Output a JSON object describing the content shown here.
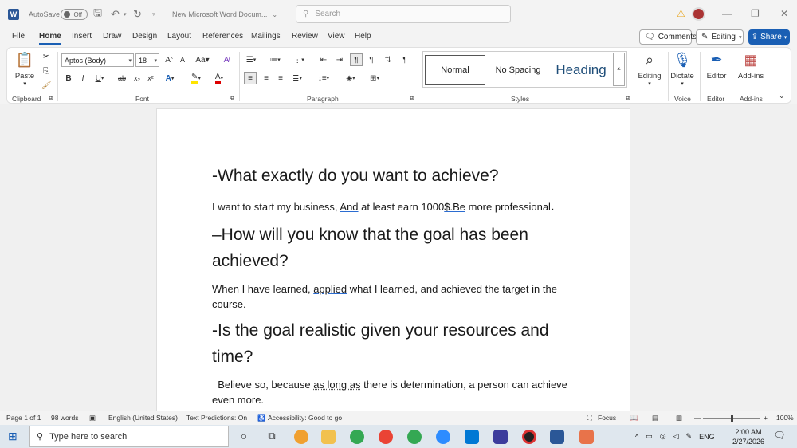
{
  "titlebar": {
    "autosave_label": "AutoSave",
    "autosave_state": "Off",
    "doc_title": "New Microsoft Word Docum...",
    "search_placeholder": "Search"
  },
  "menu": {
    "tabs": [
      "File",
      "Home",
      "Insert",
      "Draw",
      "Design",
      "Layout",
      "References",
      "Mailings",
      "Review",
      "View",
      "Help"
    ],
    "active_tab": "Home",
    "comments_label": "Comments",
    "editing_label": "Editing",
    "share_label": "Share"
  },
  "ribbon": {
    "paste_label": "Paste",
    "font_name": "Aptos (Body)",
    "font_size": "18",
    "groups": {
      "clipboard": "Clipboard",
      "font": "Font",
      "paragraph": "Paragraph",
      "styles": "Styles",
      "voice": "Voice",
      "editor": "Editor",
      "addins": "Add-ins"
    },
    "styles": [
      "Normal",
      "No Spacing",
      "Heading"
    ],
    "editing_btn": "Editing",
    "dictate_btn": "Dictate",
    "editor_btn": "Editor",
    "addins_btn": "Add-ins"
  },
  "document": {
    "h1": "-What exactly do you want to achieve?",
    "p1_a": "I want to start my business, ",
    "p1_b": "And",
    "p1_c": " at least earn 1000",
    "p1_d": "$.Be",
    "p1_e": " more professional",
    "p1_f": ".",
    "h2": "–How will you know that the goal has been achieved?",
    "p2_a": "When I have learned, ",
    "p2_b": "applied",
    "p2_c": " what I learned, and achieved the target in the course.",
    "h3": "-Is the goal realistic given your resources and time?",
    "p3_a": "  Believe so, because ",
    "p3_b": "as long as",
    "p3_c": " there is determination, a person can achieve even more."
  },
  "statusbar": {
    "page": "Page 1 of 1",
    "words": "98 words",
    "language": "English (United States)",
    "text_predictions": "Text Predictions: On",
    "accessibility": "Accessibility: Good to go",
    "focus": "Focus",
    "zoom": "100%",
    "zoom_fraction": 0.5
  },
  "taskbar": {
    "search_placeholder": "Type here to search",
    "lang": "ENG",
    "time": "2:00 AM",
    "date": "2/27/2026"
  },
  "colors": {
    "accent": "#1a5fb4",
    "word_blue": "#2b5797",
    "warning": "#e8a317"
  }
}
